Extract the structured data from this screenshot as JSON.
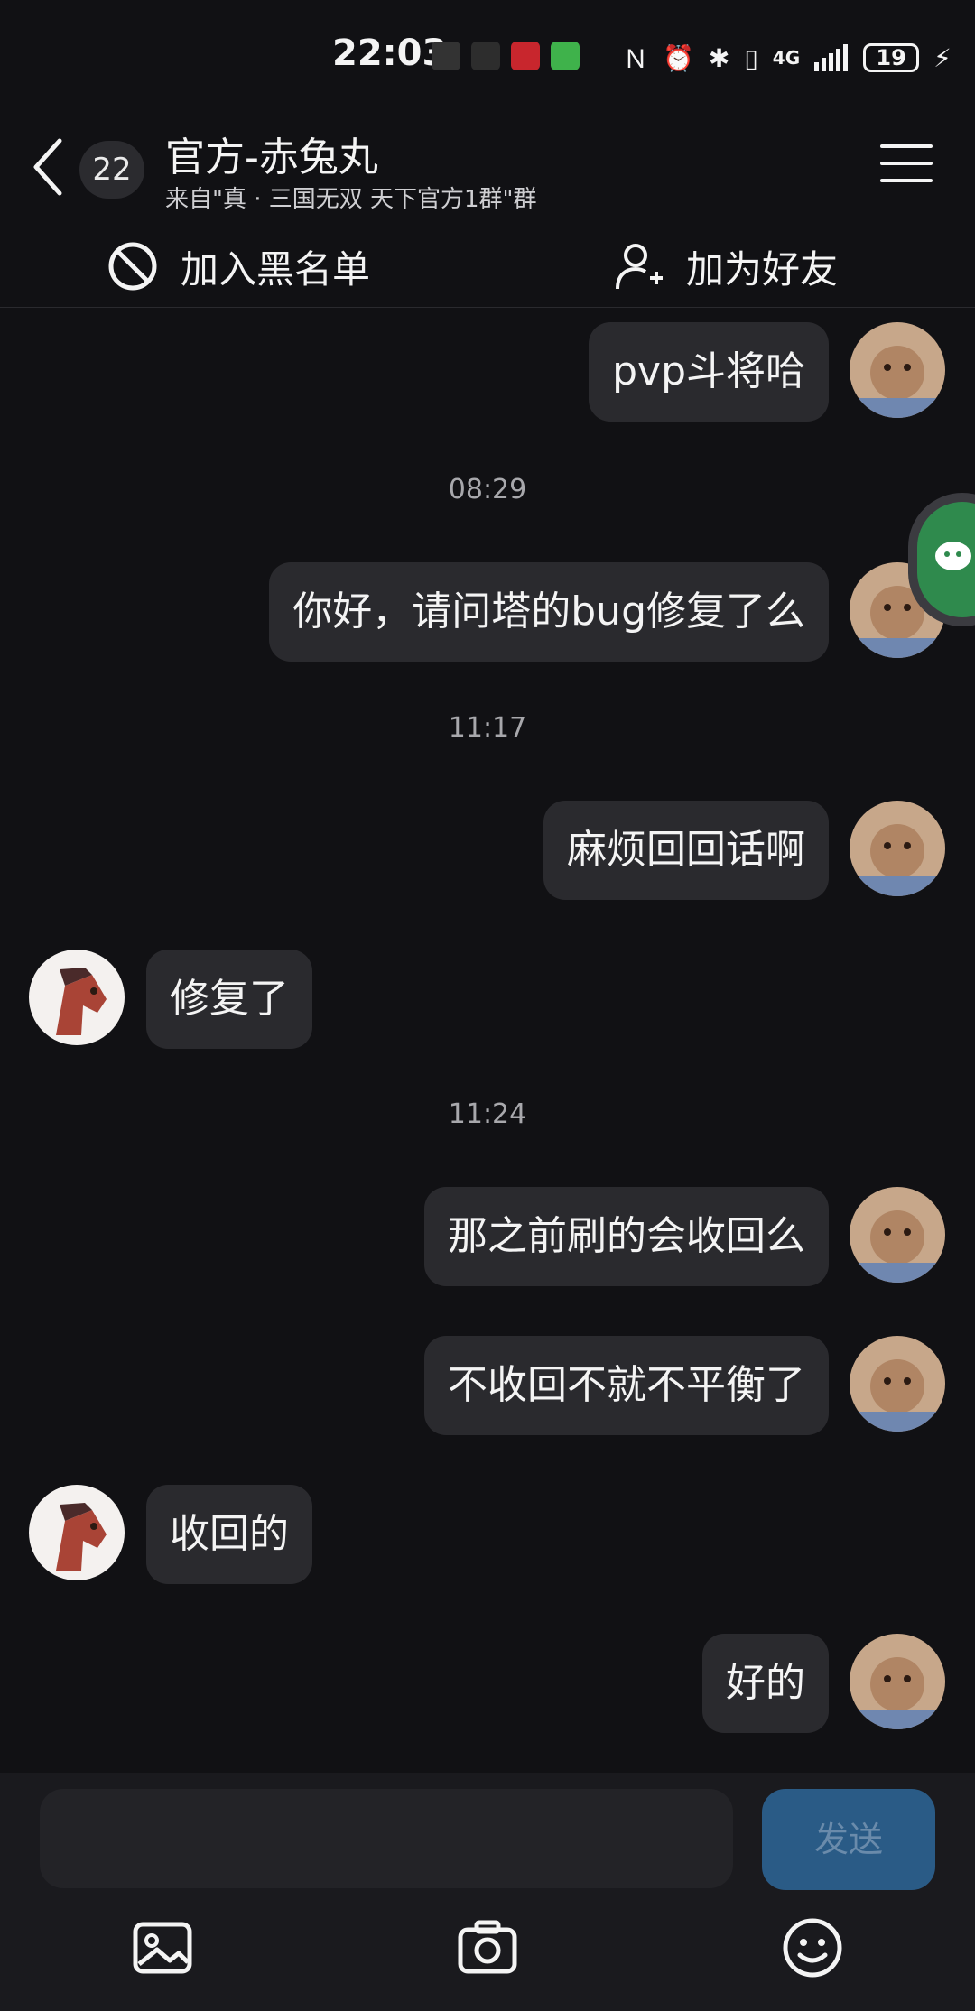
{
  "status_bar": {
    "time": "22:03",
    "network": "4G",
    "battery": "19"
  },
  "header": {
    "unread_count": "22",
    "title": "官方-赤兔丸",
    "subtitle": "来自\"真 · 三国无双 天下官方1群\"群"
  },
  "actions": {
    "blacklist": "加入黑名单",
    "add_friend": "加为好友"
  },
  "messages": [
    {
      "from": "me",
      "text": "pvp斗将哈"
    },
    {
      "type": "time",
      "text": "08:29"
    },
    {
      "from": "me",
      "text": "你好，请问塔的bug修复了么"
    },
    {
      "type": "time",
      "text": "11:17"
    },
    {
      "from": "me",
      "text": "麻烦回回话啊"
    },
    {
      "from": "other",
      "text": "修复了"
    },
    {
      "type": "time",
      "text": "11:24"
    },
    {
      "from": "me",
      "text": "那之前刷的会收回么"
    },
    {
      "from": "me",
      "text": "不收回不就不平衡了"
    },
    {
      "from": "other",
      "text": "收回的"
    },
    {
      "from": "me",
      "text": "好的"
    }
  ],
  "input": {
    "placeholder": "",
    "send_label": "发送"
  }
}
